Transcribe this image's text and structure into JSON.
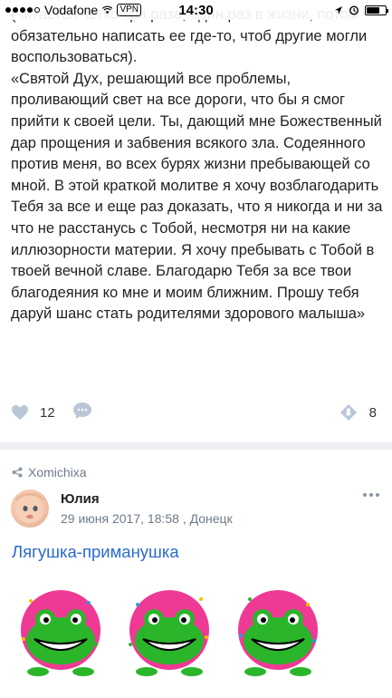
{
  "status_bar": {
    "carrier": "Vodafone",
    "vpn": "VPN",
    "time": "14:30",
    "battery_level": 0.72
  },
  "post": {
    "paragraphs": [
      "(читается четко три раза, один раз в жизни, потом обязательно написать ее где-то, чтоб другие могли воспользоваться).",
      "«Святой Дух, решающий все проблемы, проливающий свет на все дороги, что бы я смог прийти к своей цели. Ты, дающий мне Божественный дар прощения и забвения всякого зла. Содеянного против меня, во всех бурях жизни пребывающей со мной. В этой краткой молитве я хочу возблагодарить Тебя за все и еще раз доказать, что я никогда и ни за что не расстанусь с Тобой, несмотря ни на какие иллюзорности материи. Я хочу пребывать с Тобой в твоей вечной славе. Благодарю Тебя за все твои благодеяния ко мне и моим ближним. Прошу тебя даруй шанс стать родителями здорового малыша»"
    ],
    "likes": "12",
    "shares": "8"
  },
  "next_post": {
    "source": "Xomichixa",
    "author": "Юлия",
    "meta": "29 июня 2017, 18:58 , Донецк",
    "title": "Лягушка-приманушка"
  },
  "colors": {
    "accent": "#2a6ad0",
    "muted": "#6d7a89",
    "icon": "#b9c6d6",
    "frog_bg": "#ee3a94",
    "frog_green": "#2bb52b"
  }
}
